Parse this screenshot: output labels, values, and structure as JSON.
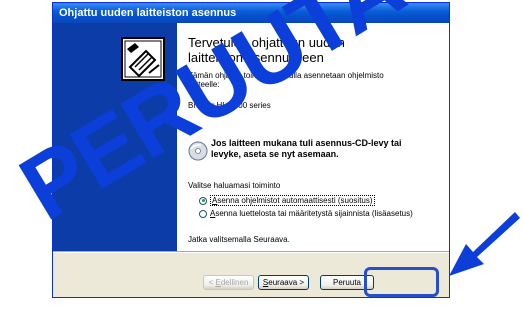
{
  "dialog": {
    "title": "Ohjattu uuden laitteiston asennus",
    "heading": "Tervetuloa ohjattuun uuden laitteiston asennukseen",
    "intro": "Tämän ohjatun toiminnon avulla asennetaan ohjelmisto laitteelle:",
    "device": "Brother HL-2400 series",
    "cd_text": "Jos laitteen mukana tuli asennus-CD-levy tai levyke, aseta se nyt asemaan.",
    "choose_label": "Valitse haluamasi toiminto",
    "options": [
      {
        "prefix": "",
        "key": "A",
        "rest": "senna ohjelmistot automaattisesti (suositus)",
        "checked": true
      },
      {
        "prefix": "",
        "key": "A",
        "rest": "senna luettelosta tai määritetystä sijainnista (lisäasetus)",
        "checked": false
      }
    ],
    "continue_text": "Jatka valitsemalla Seuraava."
  },
  "buttons": {
    "back": {
      "key": "E",
      "rest": "dellinen",
      "pre": "< "
    },
    "next": {
      "key": "S",
      "rest": "euraava",
      "post": " >"
    },
    "cancel": "Peruuta"
  },
  "overlay": {
    "watermark": "PERUUTA",
    "color": "#0c3fd9"
  }
}
